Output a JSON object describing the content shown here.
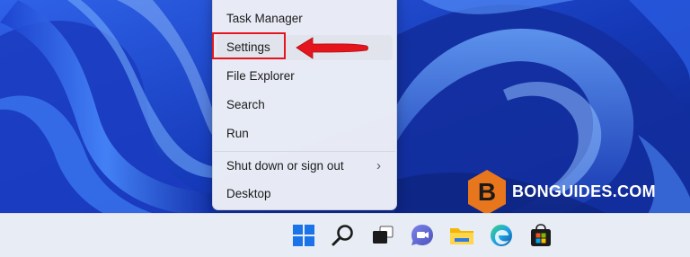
{
  "context_menu": {
    "items": [
      {
        "label": "Task Manager"
      },
      {
        "label": "Settings"
      },
      {
        "label": "File Explorer"
      },
      {
        "label": "Search"
      },
      {
        "label": "Run"
      },
      {
        "label": "Shut down or sign out",
        "has_submenu": true
      },
      {
        "label": "Desktop"
      }
    ],
    "highlighted_item": "Settings",
    "submenu_chevron": "›"
  },
  "annotation": {
    "highlight_color": "#e4151c"
  },
  "watermark": {
    "text": "BONGUIDES.COM",
    "logo_letter": "B",
    "logo_color": "#e8761c"
  },
  "taskbar": {
    "icons": [
      "windows-start-icon",
      "search-icon",
      "task-view-icon",
      "chat-icon",
      "file-explorer-icon",
      "edge-icon",
      "store-icon"
    ]
  },
  "colors": {
    "accent": "#1d43c9",
    "taskbar_bg": "#e8ecf4",
    "menu_bg": "#eef1f7"
  }
}
